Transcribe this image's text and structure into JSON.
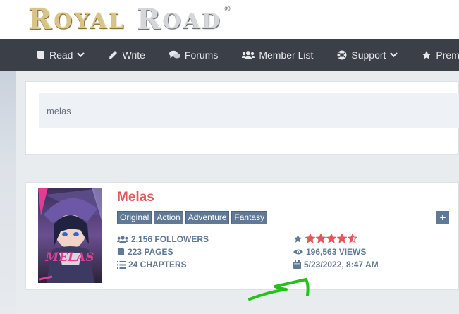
{
  "logo": {
    "part1_first": "R",
    "part1_rest": "OYAL",
    "part2_first": "R",
    "part2_rest": "OAD",
    "reg": "®"
  },
  "nav": {
    "items": [
      {
        "label": "Read",
        "icon": "book-icon",
        "dropdown": true
      },
      {
        "label": "Write",
        "icon": "pencil-icon",
        "dropdown": false
      },
      {
        "label": "Forums",
        "icon": "comments-icon",
        "dropdown": false
      },
      {
        "label": "Member List",
        "icon": "users-icon",
        "dropdown": false
      },
      {
        "label": "Support",
        "icon": "life-ring-icon",
        "dropdown": true
      },
      {
        "label": "Premium",
        "icon": "star-icon",
        "dropdown": false
      }
    ]
  },
  "search": {
    "value": "melas"
  },
  "fiction": {
    "title": "Melas",
    "cover_text": "MELAS",
    "tags": [
      "Original",
      "Action",
      "Adventure",
      "Fantasy"
    ],
    "plus_label": "+",
    "followers": "2,156 FOLLOWERS",
    "pages": "223 PAGES",
    "chapters": "24 CHAPTERS",
    "rating": 4.5,
    "views": "196,563 VIEWS",
    "updated": "5/23/2022, 8:47 AM"
  },
  "colors": {
    "nav_bg": "#3a3f48",
    "title": "#e0585b",
    "tag_bg": "#5f7996",
    "stat_text": "#5f7996",
    "star": "#e0585b",
    "annotation": "#22c21a"
  }
}
